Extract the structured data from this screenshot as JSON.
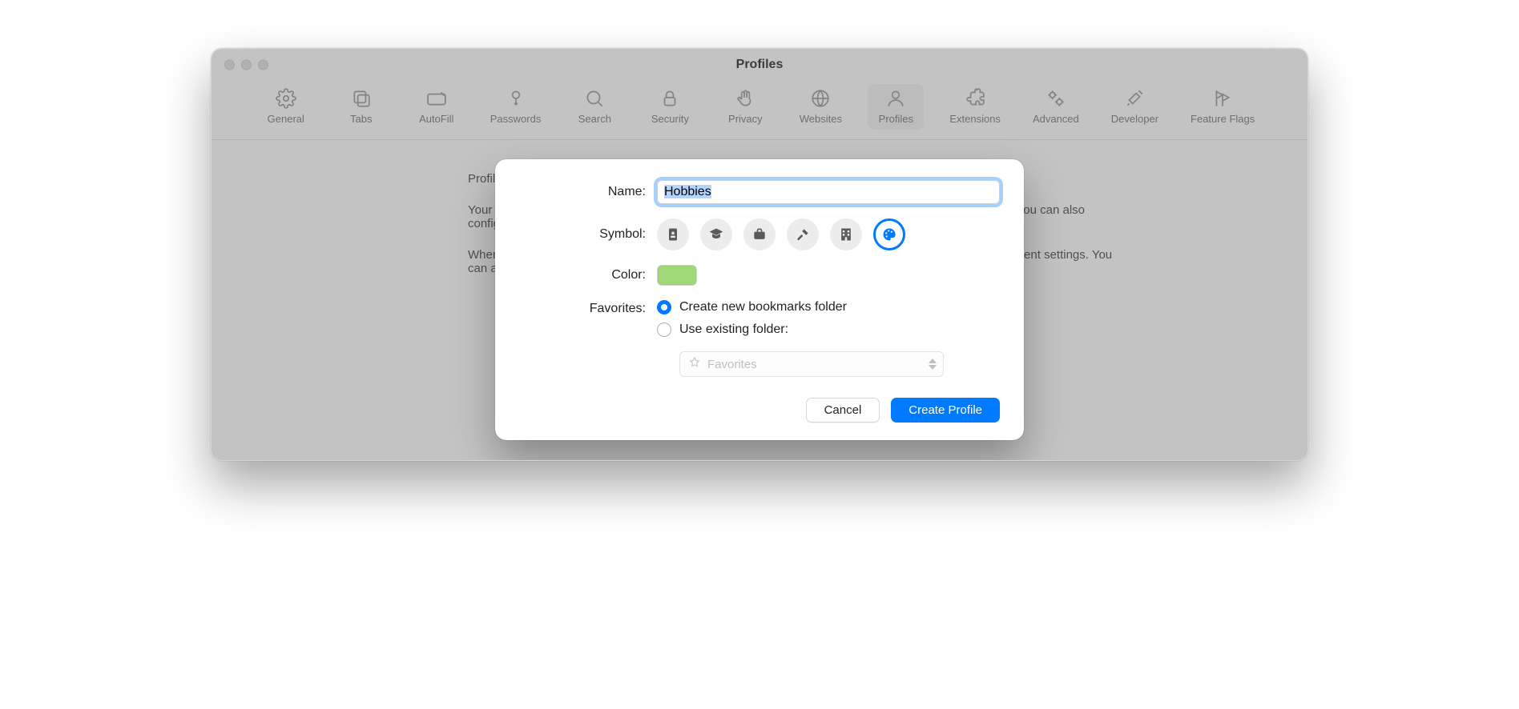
{
  "window": {
    "title": "Profiles"
  },
  "toolbar": {
    "items": [
      {
        "label": "General"
      },
      {
        "label": "Tabs"
      },
      {
        "label": "AutoFill"
      },
      {
        "label": "Passwords"
      },
      {
        "label": "Search"
      },
      {
        "label": "Security"
      },
      {
        "label": "Privacy"
      },
      {
        "label": "Websites"
      },
      {
        "label": "Profiles"
      },
      {
        "label": "Extensions"
      },
      {
        "label": "Advanced"
      },
      {
        "label": "Developer"
      },
      {
        "label": "Feature Flags"
      }
    ],
    "active_index": 8
  },
  "body": {
    "p1": "Profiles allow you to keep your browsing separate for topics like Work, School, or Personal browsing.",
    "p2": "Your history, cookies, website data, and more will be separate depending on which profile you're using. You can also configure different Tab Groups, Favorites, and extensions for each profile.",
    "p3": "When you create a profile for the first time, we'll add a default Personal profile for you based on your current settings. You can always edit this profile later and give it a custom name or custom Favorites."
  },
  "sheet": {
    "labels": {
      "name": "Name:",
      "symbol": "Symbol:",
      "color": "Color:",
      "favorites": "Favorites:"
    },
    "name_value": "Hobbies",
    "symbols": [
      "id-card",
      "graduation-cap",
      "briefcase",
      "hammer",
      "building",
      "palette"
    ],
    "selected_symbol_index": 5,
    "color_hex": "#a0d978",
    "radio_options": {
      "create_new": "Create new bookmarks folder",
      "use_existing": "Use existing folder:"
    },
    "selected_radio": "create_new",
    "dropdown_value": "Favorites",
    "buttons": {
      "cancel": "Cancel",
      "create": "Create Profile"
    }
  }
}
